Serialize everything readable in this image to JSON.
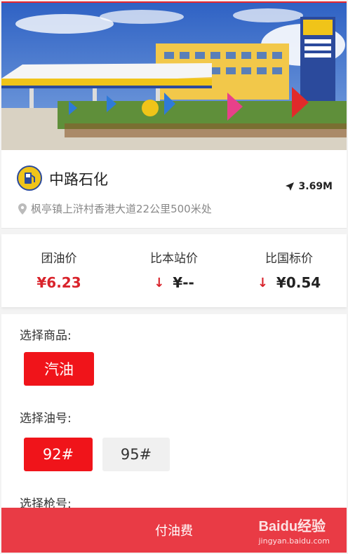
{
  "station": {
    "name": "中路石化",
    "distance": "3.69M",
    "address": "枫亭镇上浒村香港大道22公里500米处"
  },
  "prices": [
    {
      "label": "团油价",
      "value": "¥6.23",
      "arrow": false,
      "color": "#d9232b"
    },
    {
      "label": "比本站价",
      "value": "¥--",
      "arrow": true,
      "color": "#222222"
    },
    {
      "label": "比国标价",
      "value": "¥0.54",
      "arrow": true,
      "color": "#222222"
    }
  ],
  "product": {
    "label": "选择商品:",
    "options": [
      {
        "text": "汽油",
        "selected": true
      }
    ]
  },
  "grade": {
    "label": "选择油号:",
    "options": [
      {
        "text": "92#",
        "selected": true
      },
      {
        "text": "95#",
        "selected": false
      }
    ]
  },
  "nozzle": {
    "label": "选择枪号:"
  },
  "footer": {
    "pay_label": "付油费",
    "watermark_main": "Baidu经验",
    "watermark_sub": "jingyan.baidu.com"
  },
  "colors": {
    "accent": "#f0141a",
    "pay_bar": "#e93b45",
    "price_red": "#d9232b"
  },
  "icons": [
    "location-pin-icon",
    "navigation-arrow-icon",
    "down-arrow-icon",
    "station-logo-icon"
  ]
}
